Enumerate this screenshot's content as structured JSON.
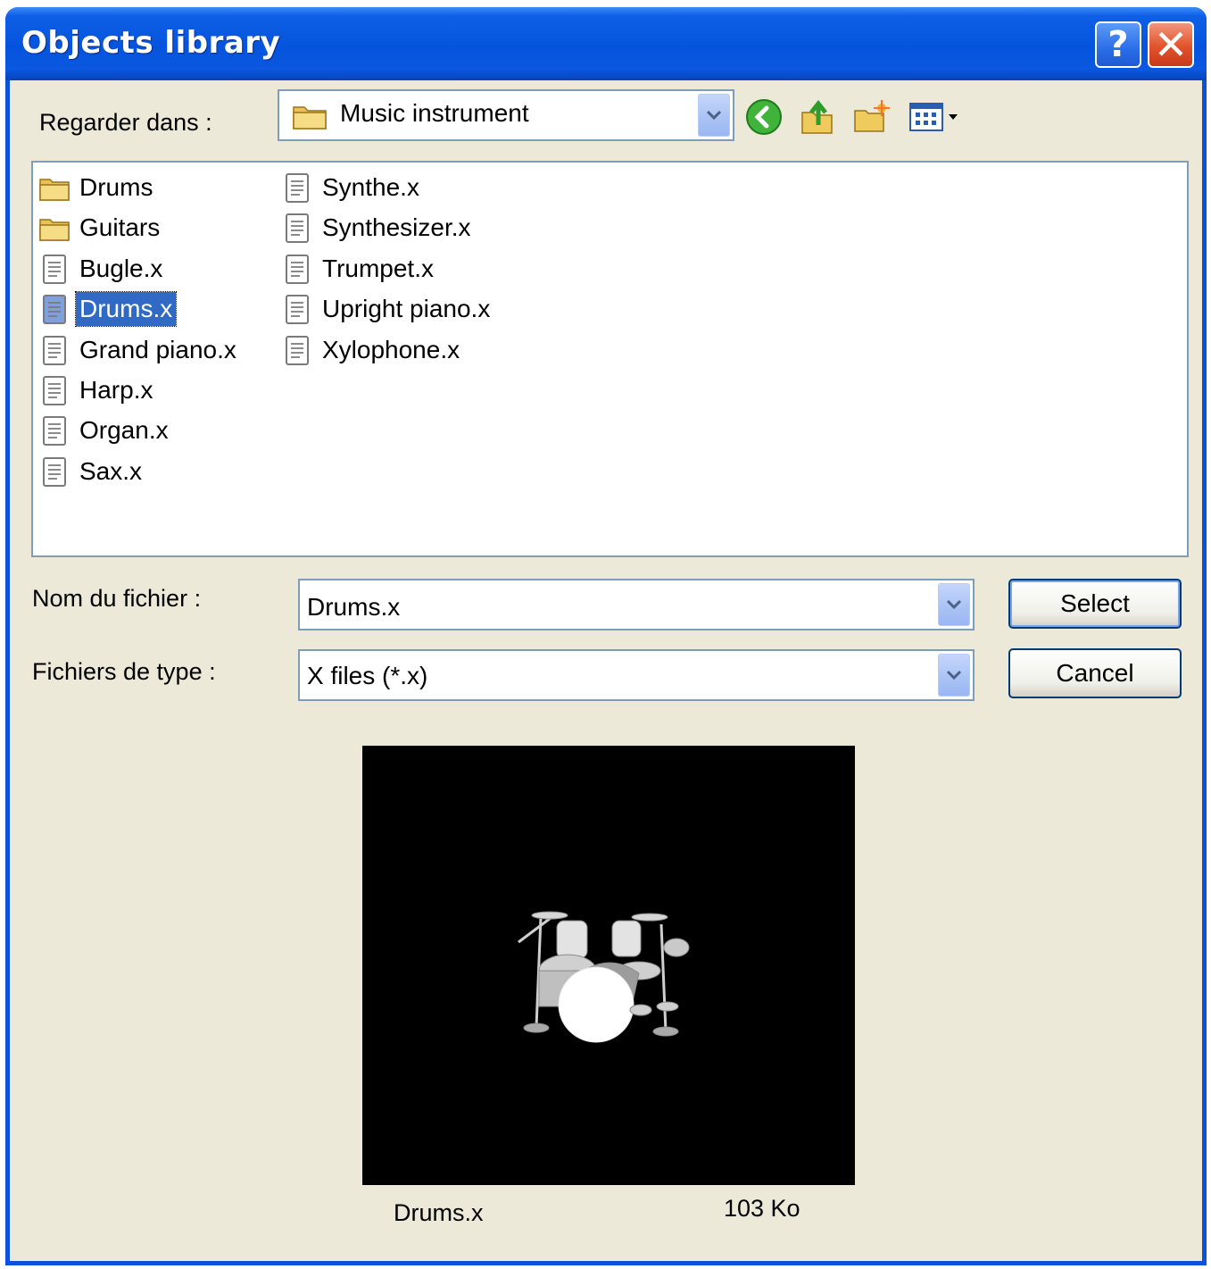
{
  "window": {
    "title": "Objects library"
  },
  "titlebar": {
    "help_label": "?",
    "close_label": "✕"
  },
  "look_in": {
    "label": "Regarder dans :",
    "value": "Music instrument",
    "toolbar": [
      "back-icon",
      "up-folder-icon",
      "new-folder-icon",
      "view-menu-icon"
    ]
  },
  "files": {
    "column1": [
      {
        "name": "Drums",
        "type": "folder"
      },
      {
        "name": "Guitars",
        "type": "folder"
      },
      {
        "name": "Bugle.x",
        "type": "file"
      },
      {
        "name": "Drums.x",
        "type": "file",
        "selected": true
      },
      {
        "name": "Grand piano.x",
        "type": "file"
      },
      {
        "name": "Harp.x",
        "type": "file"
      },
      {
        "name": "Organ.x",
        "type": "file"
      },
      {
        "name": "Sax.x",
        "type": "file"
      }
    ],
    "column2": [
      {
        "name": "Synthe.x",
        "type": "file"
      },
      {
        "name": "Synthesizer.x",
        "type": "file"
      },
      {
        "name": "Trumpet.x",
        "type": "file"
      },
      {
        "name": "Upright piano.x",
        "type": "file"
      },
      {
        "name": "Xylophone.x",
        "type": "file"
      }
    ]
  },
  "filename": {
    "label": "Nom du fichier :",
    "value": "Drums.x"
  },
  "filetype": {
    "label": "Fichiers de type :",
    "value": "X files (*.x)"
  },
  "buttons": {
    "select": "Select",
    "cancel": "Cancel"
  },
  "preview": {
    "filename": "Drums.x",
    "size": "103 Ko"
  },
  "colors": {
    "title_bar": "#0A52D9",
    "dialog_bg": "#ECE9D8",
    "selection": "#316AC5",
    "field_border": "#7F9DB9"
  }
}
